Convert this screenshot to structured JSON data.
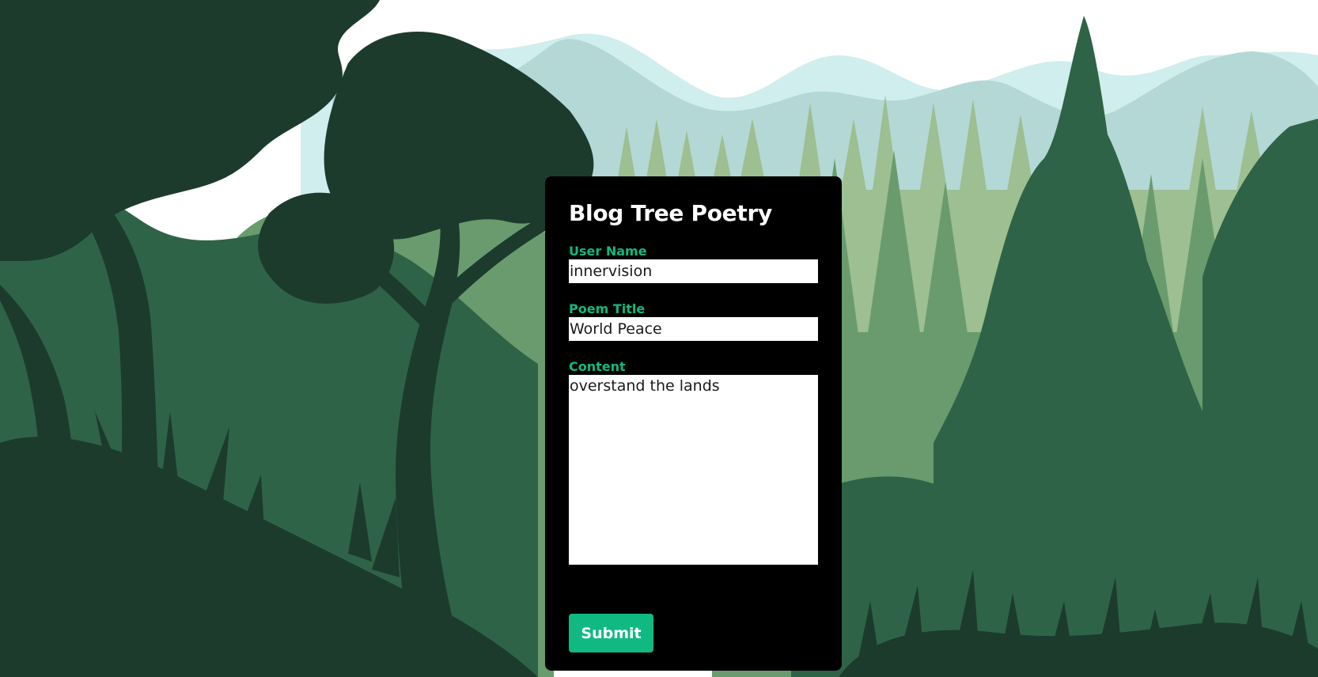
{
  "page": {
    "title": "Blog Tree Poetry"
  },
  "form": {
    "username_label": "User Name",
    "username_value": "innervision",
    "poem_title_label": "Poem Title",
    "poem_title_value": "World Peace",
    "content_label": "Content",
    "content_value": "overstand the lands",
    "submit_label": "Submit"
  },
  "colors": {
    "accent": "#10b981",
    "card_background": "#000000",
    "sky": "#ffffff",
    "far_mountain": "#cfeeed",
    "mid_mountain": "#b3d8d6",
    "far_pines": "#9dbf91",
    "mid_forest": "#6a9b6e",
    "near_forest": "#2f6347",
    "darkest_foliage": "#1c3b2d"
  }
}
